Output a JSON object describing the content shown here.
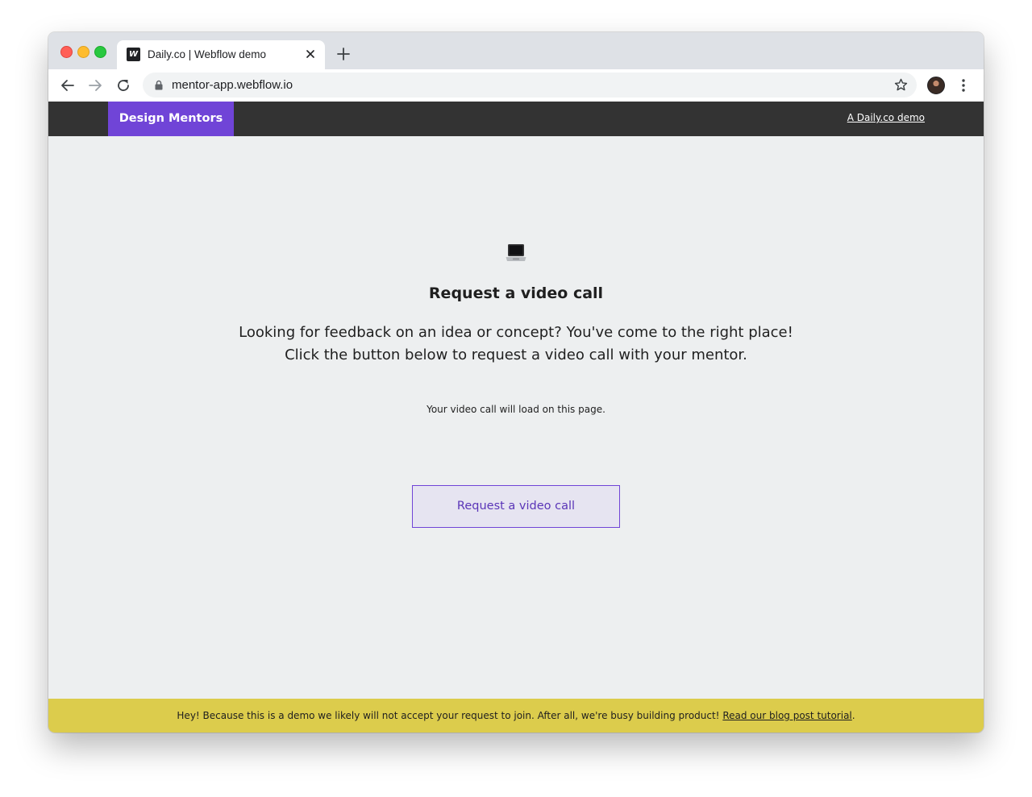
{
  "browser": {
    "tab_title": "Daily.co | Webflow demo",
    "favicon_letter": "W",
    "url": "mentor-app.webflow.io",
    "icons": [
      "back-icon",
      "forward-icon",
      "reload-icon",
      "lock-icon",
      "star-icon",
      "menu-icon",
      "close-icon",
      "plus-icon"
    ]
  },
  "site": {
    "brand": "Design Mentors",
    "nav_link": "A Daily.co demo"
  },
  "main": {
    "icon": "laptop-icon",
    "heading": "Request a video call",
    "lead_line1": "Looking for feedback on an idea or concept? You've come to the right place!",
    "lead_line2": "Click the button below to request a video call with your mentor.",
    "note": "Your video call will load on this page.",
    "button_label": "Request a video call"
  },
  "banner": {
    "text": "Hey! Because this is a demo we likely will not accept your request to join. After all, we're busy building product!",
    "link_text": "Read our blog post tutorial",
    "suffix": "."
  },
  "colors": {
    "brand": "#7044d7",
    "nav_background": "#333333",
    "page_background": "#edeff0",
    "banner_background": "#dccc4c",
    "button_background": "#e6e4f1"
  }
}
